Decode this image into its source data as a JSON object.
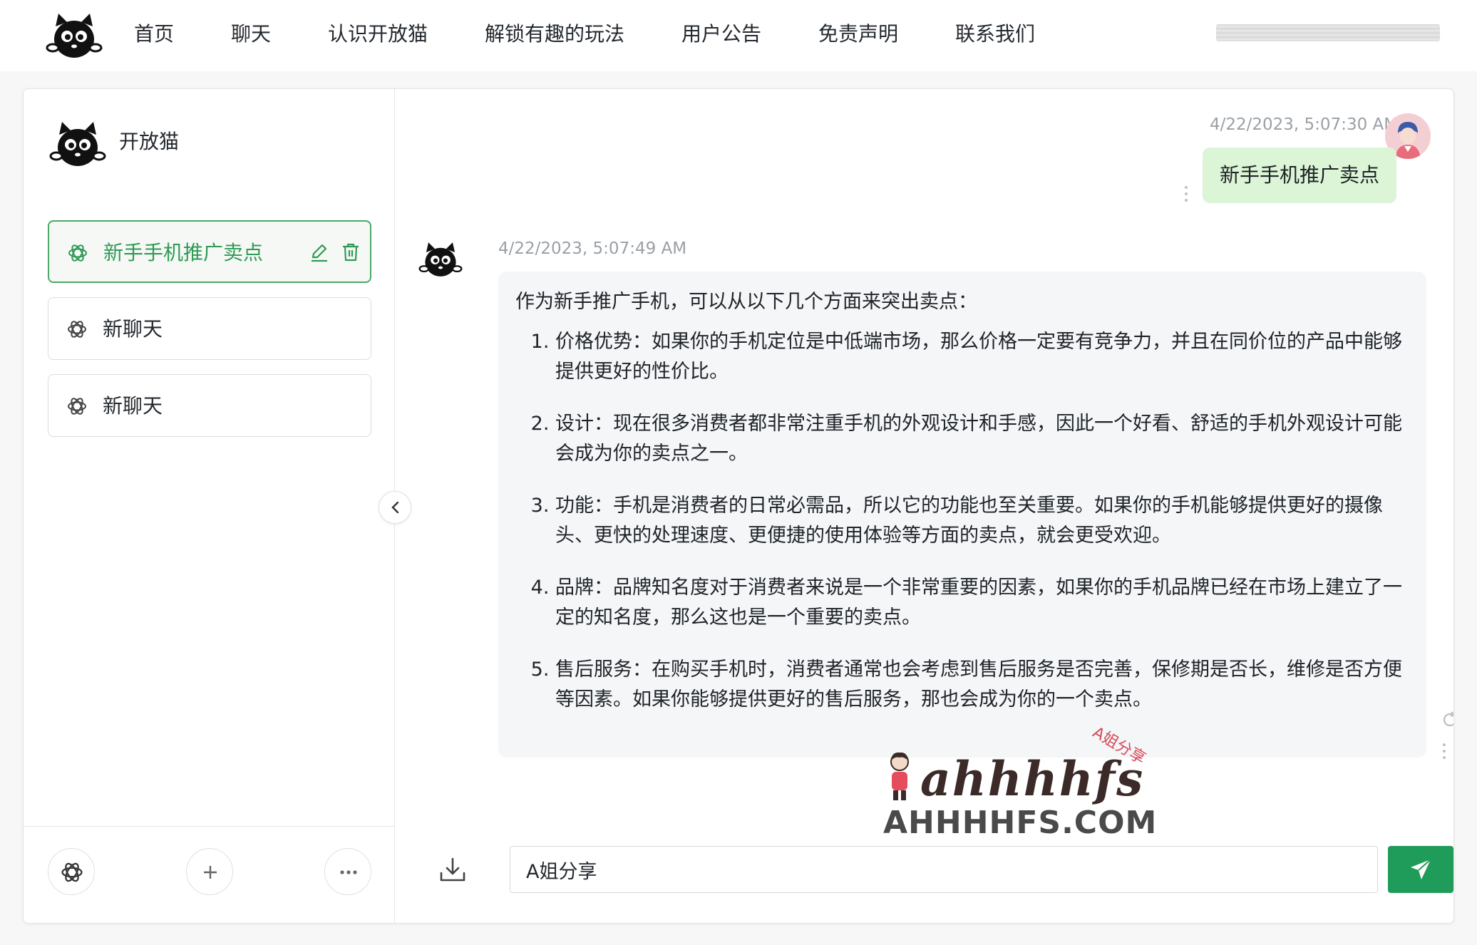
{
  "nav": {
    "items": [
      "首页",
      "聊天",
      "认识开放猫",
      "解锁有趣的玩法",
      "用户公告",
      "免责声明",
      "联系我们"
    ],
    "logo_icon": "cat-logo-icon"
  },
  "sidebar": {
    "title": "开放猫",
    "sessions": [
      {
        "label": "新手手机推广卖点",
        "active": true
      },
      {
        "label": "新聊天",
        "active": false
      },
      {
        "label": "新聊天",
        "active": false
      }
    ],
    "footer_icons": [
      "openai-icon",
      "plus-icon",
      "more-icon"
    ]
  },
  "chat": {
    "user_message": {
      "time": "4/22/2023, 5:07:30 AM",
      "text": "新手手机推广卖点"
    },
    "bot_message": {
      "time": "4/22/2023, 5:07:49 AM",
      "intro": "作为新手推广手机，可以从以下几个方面来突出卖点：",
      "points": [
        "价格优势：如果你的手机定位是中低端市场，那么价格一定要有竞争力，并且在同价位的产品中能够提供更好的性价比。",
        "设计：现在很多消费者都非常注重手机的外观设计和手感，因此一个好看、舒适的手机外观设计可能会成为你的卖点之一。",
        "功能：手机是消费者的日常必需品，所以它的功能也至关重要。如果你的手机能够提供更好的摄像头、更快的处理速度、更便捷的使用体验等方面的卖点，就会更受欢迎。",
        "品牌：品牌知名度对于消费者来说是一个非常重要的因素，如果你的手机品牌已经在市场上建立了一定的知名度，那么这也是一个重要的卖点。",
        "售后服务：在购买手机时，消费者通常也会考虑到售后服务是否完善，保修期是否长，维修是否方便等因素。如果你能够提供更好的售后服务，那也会成为你的一个卖点。"
      ]
    }
  },
  "watermark": {
    "script": "ahhhhfs",
    "badge": "A姐分享",
    "url": "AHHHHFS.COM"
  },
  "input": {
    "value": "A姐分享"
  },
  "colors": {
    "accent": "#209c5a",
    "active_session": "#2f9a55",
    "user_bubble": "#dcf5d6",
    "bot_bubble": "#f4f6f8"
  }
}
